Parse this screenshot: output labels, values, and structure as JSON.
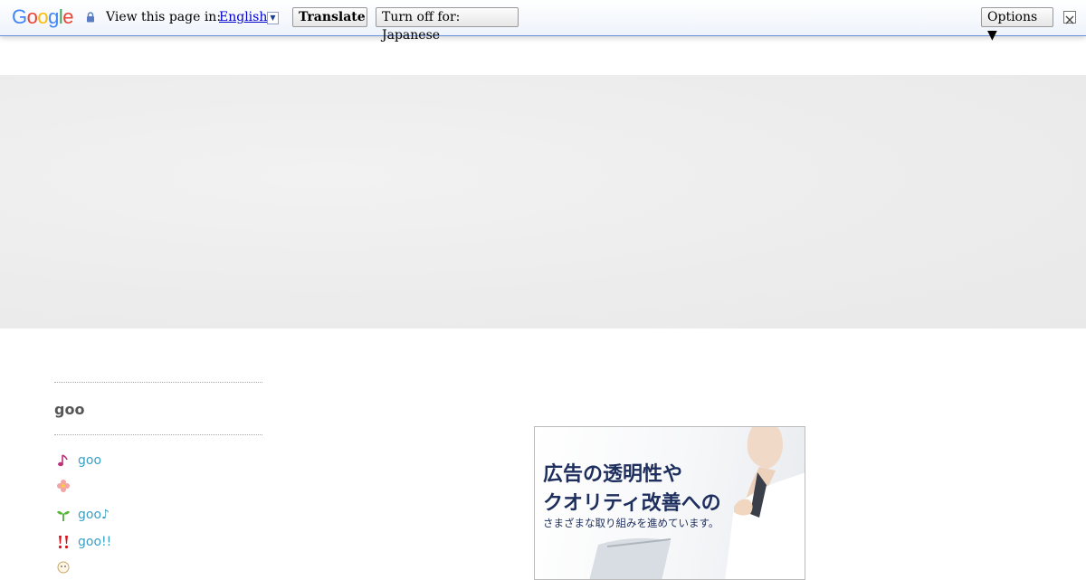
{
  "translate_bar": {
    "logo_letters": [
      "G",
      "o",
      "o",
      "g",
      "l",
      "e"
    ],
    "logo_colors": [
      "#4285f4",
      "#ea4335",
      "#fbbc05",
      "#4285f4",
      "#34a853",
      "#ea4335"
    ],
    "view_label": "View this page in:",
    "language": "English",
    "language_arrow": "▼",
    "translate_label": "Translate",
    "turn_off_label": "Turn off for: Japanese",
    "options_label": "Options ▼",
    "close_icon": "close-icon"
  },
  "sidebar": {
    "heading": "goo",
    "items": [
      {
        "icon": "music-note-icon",
        "label": "goo"
      },
      {
        "icon": "flower-icon",
        "label": ""
      },
      {
        "icon": "sprout-icon",
        "label": "goo♪"
      },
      {
        "icon": "double-exclamation-icon",
        "label": "goo!!"
      },
      {
        "icon": "face-icon",
        "label": ""
      }
    ]
  },
  "ad": {
    "line1": "広告の透明性や",
    "line2": "クオリティ改善への",
    "line3": "さまざまな取り組みを進めています。"
  },
  "colors": {
    "link": "#3aa0c8",
    "ad_text": "#1e2f5e",
    "bar_border": "#6b90da"
  }
}
